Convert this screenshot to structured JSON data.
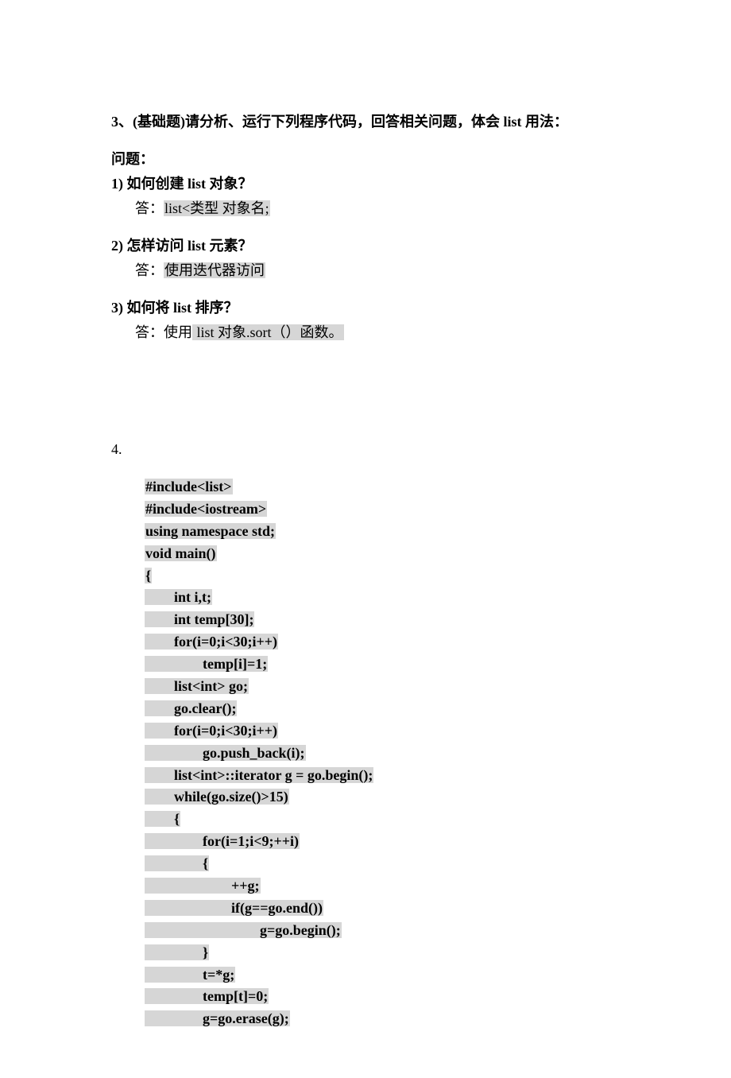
{
  "q3": {
    "title": "3、(基础题)请分析、运行下列程序代码，回答相关问题，体会 list 用法：",
    "sub": "问题：",
    "items": [
      {
        "q": "1)  如何创建 list 对象？",
        "a_prefix": " 答：",
        "a": "list<类型  对象名;"
      },
      {
        "q": "2)  怎样访问 list 元素？",
        "a_prefix": " 答：",
        "a": "使用迭代器访问"
      },
      {
        "q": "3)  如何将 list 排序？",
        "a_prefix": " 答：使用",
        "a": "   list 对象.sort（）函数。"
      }
    ]
  },
  "q4": {
    "label": "4.",
    "code": [
      {
        "i": 0,
        "t": "#include<list>"
      },
      {
        "i": 0,
        "t": "#include<iostream>"
      },
      {
        "i": 0,
        "t": "using namespace std;"
      },
      {
        "i": 0,
        "t": "void main()"
      },
      {
        "i": 0,
        "t": "{"
      },
      {
        "i": 1,
        "t": "int i,t;"
      },
      {
        "i": 1,
        "t": "int temp[30];"
      },
      {
        "i": 1,
        "t": "for(i=0;i<30;i++)"
      },
      {
        "i": 2,
        "t": "temp[i]=1;"
      },
      {
        "i": 1,
        "t": "list<int> go;"
      },
      {
        "i": 1,
        "t": "go.clear();"
      },
      {
        "i": 1,
        "t": "for(i=0;i<30;i++)"
      },
      {
        "i": 2,
        "t": "go.push_back(i);"
      },
      {
        "i": 1,
        "t": "list<int>::iterator g = go.begin();"
      },
      {
        "i": 1,
        "t": "while(go.size()>15)"
      },
      {
        "i": 1,
        "t": "{"
      },
      {
        "i": 2,
        "t": "for(i=1;i<9;++i)"
      },
      {
        "i": 2,
        "t": "{"
      },
      {
        "i": 3,
        "t": "++g;"
      },
      {
        "i": 3,
        "t": "if(g==go.end())"
      },
      {
        "i": 4,
        "t": "g=go.begin();"
      },
      {
        "i": 2,
        "t": "}"
      },
      {
        "i": 2,
        "t": "t=*g;"
      },
      {
        "i": 2,
        "t": "temp[t]=0;"
      },
      {
        "i": 2,
        "t": "g=go.erase(g);"
      }
    ]
  }
}
